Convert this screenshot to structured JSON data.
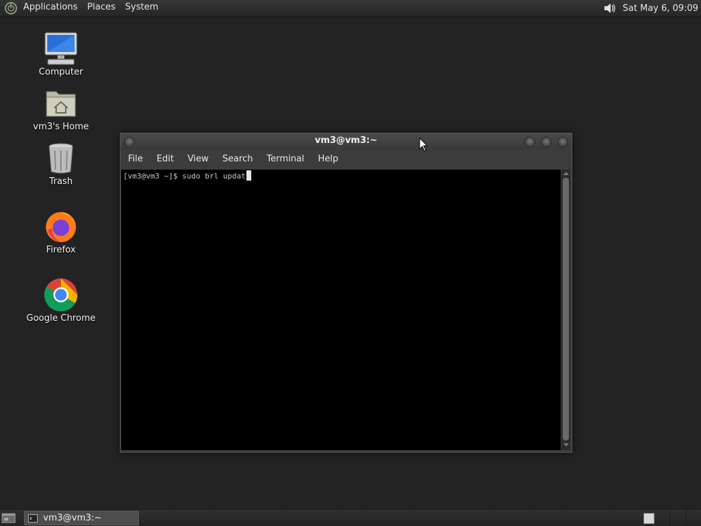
{
  "top_panel": {
    "menus": [
      "Applications",
      "Places",
      "System"
    ],
    "clock": "Sat May  6, 09:09"
  },
  "desktop": {
    "icons": [
      {
        "label": "Computer",
        "icon": "computer-icon"
      },
      {
        "label": "vm3's Home",
        "icon": "home-folder-icon"
      },
      {
        "label": "Trash",
        "icon": "trash-icon"
      },
      {
        "label": "Firefox",
        "icon": "firefox-icon"
      },
      {
        "label": "Google Chrome",
        "icon": "chrome-icon"
      }
    ]
  },
  "terminal": {
    "title": "vm3@vm3:~",
    "menus": [
      "File",
      "Edit",
      "View",
      "Search",
      "Terminal",
      "Help"
    ],
    "prompt_line": "[vm3@vm3 ~]$ sudo brl updat"
  },
  "taskbar": {
    "window_label": "vm3@vm3:~"
  },
  "colors": {
    "desktop_bg": "#232323",
    "terminal_bg": "#000000",
    "panel_bg": "#2a2a2a"
  }
}
